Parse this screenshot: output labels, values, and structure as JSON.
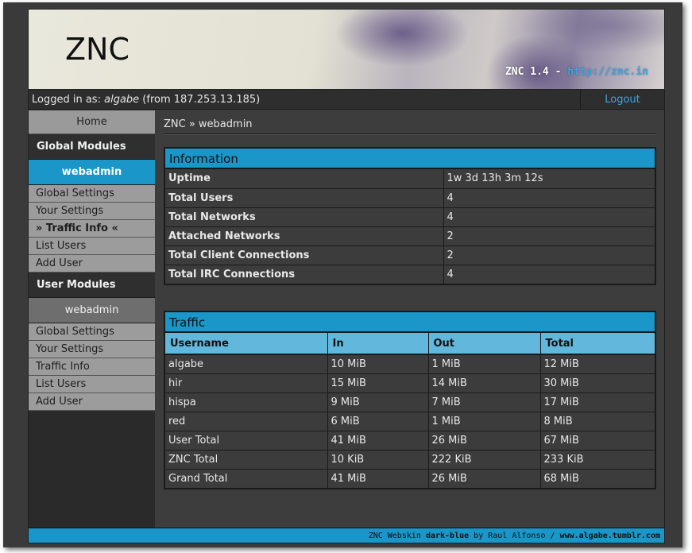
{
  "header": {
    "logo": "ZNC",
    "version_text": "ZNC 1.4 -",
    "version_link": "http://znc.in"
  },
  "login": {
    "prefix": "Logged in as:",
    "user": "algabe",
    "from": "(from 187.253.13.185)",
    "logout": "Logout"
  },
  "sidebar": {
    "home": "Home",
    "global_modules": "Global Modules",
    "global_module_name": "webadmin",
    "global_items": [
      "Global Settings",
      "Your Settings",
      "» Traffic Info «",
      "List Users",
      "Add User"
    ],
    "user_modules": "User Modules",
    "user_module_name": "webadmin",
    "user_items": [
      "Global Settings",
      "Your Settings",
      "Traffic Info",
      "List Users",
      "Add User"
    ]
  },
  "breadcrumb": "ZNC » webadmin",
  "information": {
    "title": "Information",
    "rows": [
      {
        "key": "Uptime",
        "value": "1w 3d 13h 3m 12s"
      },
      {
        "key": "Total Users",
        "value": "4"
      },
      {
        "key": "Total Networks",
        "value": "4"
      },
      {
        "key": "Attached Networks",
        "value": "2"
      },
      {
        "key": "Total Client Connections",
        "value": "2"
      },
      {
        "key": "Total IRC Connections",
        "value": "4"
      }
    ]
  },
  "traffic": {
    "title": "Traffic",
    "columns": [
      "Username",
      "In",
      "Out",
      "Total"
    ],
    "rows": [
      [
        "algabe",
        "10 MiB",
        "1 MiB",
        "12 MiB"
      ],
      [
        "hir",
        "15 MiB",
        "14 MiB",
        "30 MiB"
      ],
      [
        "hispa",
        "9 MiB",
        "7 MiB",
        "17 MiB"
      ],
      [
        "red",
        "6 MiB",
        "1 MiB",
        "8 MiB"
      ],
      [
        "User Total",
        "41 MiB",
        "26 MiB",
        "67 MiB"
      ],
      [
        "ZNC Total",
        "10 KiB",
        "222 KiB",
        "233 KiB"
      ],
      [
        "Grand Total",
        "41 MiB",
        "26 MiB",
        "68 MiB"
      ]
    ]
  },
  "footer": {
    "prefix": "ZNC Webskin",
    "skin": "dark-blue",
    "by": "by Raul Alfonso /",
    "site": "www.algabe.tumblr.com"
  },
  "colors": {
    "accent": "#1a96c8",
    "link": "#3aa6e0"
  }
}
